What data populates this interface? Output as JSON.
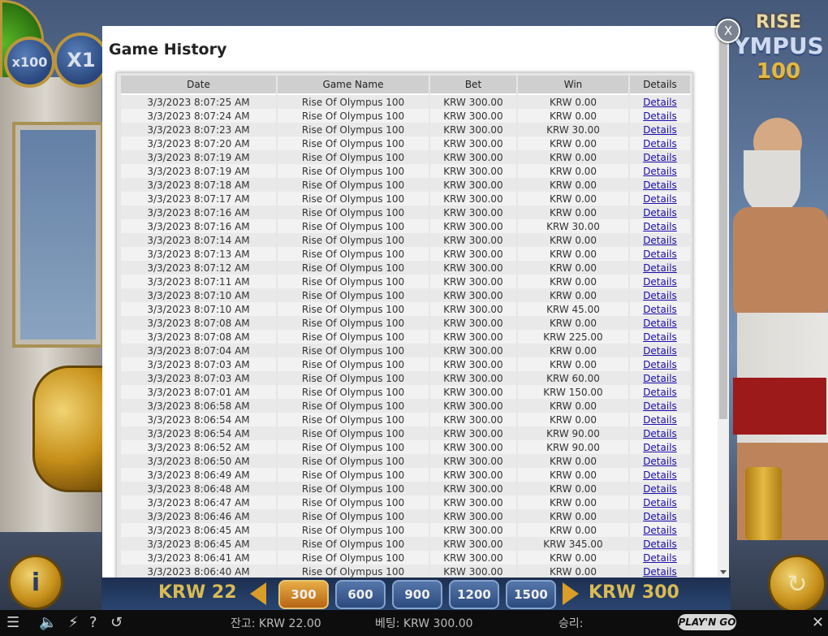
{
  "game": {
    "multipliers": [
      "x100",
      "X1"
    ],
    "logo": {
      "line1": "RISE",
      "line2": "YMPUS",
      "line3": "100"
    },
    "bet_bar": {
      "left_amount": "KRW 22",
      "right_amount": "KRW 300",
      "chips": [
        "300",
        "600",
        "900",
        "1200",
        "1500"
      ]
    },
    "info_label": "i"
  },
  "status_bar": {
    "balance": "잔고: KRW 22.00",
    "bet": "베팅: KRW 300.00",
    "win": "승리:",
    "brand": "PLAY'N GO",
    "icons": [
      "menu-icon",
      "sound-icon",
      "turbo-icon",
      "help-icon",
      "history-icon",
      "close-icon"
    ]
  },
  "modal": {
    "title": "Game History",
    "close_label": "X",
    "columns": [
      "Date",
      "Game Name",
      "Bet",
      "Win",
      "Details"
    ],
    "rows": [
      {
        "date": "3/3/2023 8:07:25 AM",
        "game": "Rise Of Olympus 100",
        "bet": "KRW 300.00",
        "win": "KRW 0.00",
        "details": "Details"
      },
      {
        "date": "3/3/2023 8:07:24 AM",
        "game": "Rise Of Olympus 100",
        "bet": "KRW 300.00",
        "win": "KRW 0.00",
        "details": "Details"
      },
      {
        "date": "3/3/2023 8:07:23 AM",
        "game": "Rise Of Olympus 100",
        "bet": "KRW 300.00",
        "win": "KRW 30.00",
        "details": "Details"
      },
      {
        "date": "3/3/2023 8:07:20 AM",
        "game": "Rise Of Olympus 100",
        "bet": "KRW 300.00",
        "win": "KRW 0.00",
        "details": "Details"
      },
      {
        "date": "3/3/2023 8:07:19 AM",
        "game": "Rise Of Olympus 100",
        "bet": "KRW 300.00",
        "win": "KRW 0.00",
        "details": "Details"
      },
      {
        "date": "3/3/2023 8:07:19 AM",
        "game": "Rise Of Olympus 100",
        "bet": "KRW 300.00",
        "win": "KRW 0.00",
        "details": "Details"
      },
      {
        "date": "3/3/2023 8:07:18 AM",
        "game": "Rise Of Olympus 100",
        "bet": "KRW 300.00",
        "win": "KRW 0.00",
        "details": "Details"
      },
      {
        "date": "3/3/2023 8:07:17 AM",
        "game": "Rise Of Olympus 100",
        "bet": "KRW 300.00",
        "win": "KRW 0.00",
        "details": "Details"
      },
      {
        "date": "3/3/2023 8:07:16 AM",
        "game": "Rise Of Olympus 100",
        "bet": "KRW 300.00",
        "win": "KRW 0.00",
        "details": "Details"
      },
      {
        "date": "3/3/2023 8:07:16 AM",
        "game": "Rise Of Olympus 100",
        "bet": "KRW 300.00",
        "win": "KRW 30.00",
        "details": "Details"
      },
      {
        "date": "3/3/2023 8:07:14 AM",
        "game": "Rise Of Olympus 100",
        "bet": "KRW 300.00",
        "win": "KRW 0.00",
        "details": "Details"
      },
      {
        "date": "3/3/2023 8:07:13 AM",
        "game": "Rise Of Olympus 100",
        "bet": "KRW 300.00",
        "win": "KRW 0.00",
        "details": "Details"
      },
      {
        "date": "3/3/2023 8:07:12 AM",
        "game": "Rise Of Olympus 100",
        "bet": "KRW 300.00",
        "win": "KRW 0.00",
        "details": "Details"
      },
      {
        "date": "3/3/2023 8:07:11 AM",
        "game": "Rise Of Olympus 100",
        "bet": "KRW 300.00",
        "win": "KRW 0.00",
        "details": "Details"
      },
      {
        "date": "3/3/2023 8:07:10 AM",
        "game": "Rise Of Olympus 100",
        "bet": "KRW 300.00",
        "win": "KRW 0.00",
        "details": "Details"
      },
      {
        "date": "3/3/2023 8:07:10 AM",
        "game": "Rise Of Olympus 100",
        "bet": "KRW 300.00",
        "win": "KRW 45.00",
        "details": "Details"
      },
      {
        "date": "3/3/2023 8:07:08 AM",
        "game": "Rise Of Olympus 100",
        "bet": "KRW 300.00",
        "win": "KRW 0.00",
        "details": "Details"
      },
      {
        "date": "3/3/2023 8:07:08 AM",
        "game": "Rise Of Olympus 100",
        "bet": "KRW 300.00",
        "win": "KRW 225.00",
        "details": "Details"
      },
      {
        "date": "3/3/2023 8:07:04 AM",
        "game": "Rise Of Olympus 100",
        "bet": "KRW 300.00",
        "win": "KRW 0.00",
        "details": "Details"
      },
      {
        "date": "3/3/2023 8:07:03 AM",
        "game": "Rise Of Olympus 100",
        "bet": "KRW 300.00",
        "win": "KRW 0.00",
        "details": "Details"
      },
      {
        "date": "3/3/2023 8:07:03 AM",
        "game": "Rise Of Olympus 100",
        "bet": "KRW 300.00",
        "win": "KRW 60.00",
        "details": "Details"
      },
      {
        "date": "3/3/2023 8:07:01 AM",
        "game": "Rise Of Olympus 100",
        "bet": "KRW 300.00",
        "win": "KRW 150.00",
        "details": "Details"
      },
      {
        "date": "3/3/2023 8:06:58 AM",
        "game": "Rise Of Olympus 100",
        "bet": "KRW 300.00",
        "win": "KRW 0.00",
        "details": "Details"
      },
      {
        "date": "3/3/2023 8:06:54 AM",
        "game": "Rise Of Olympus 100",
        "bet": "KRW 300.00",
        "win": "KRW 0.00",
        "details": "Details"
      },
      {
        "date": "3/3/2023 8:06:54 AM",
        "game": "Rise Of Olympus 100",
        "bet": "KRW 300.00",
        "win": "KRW 90.00",
        "details": "Details"
      },
      {
        "date": "3/3/2023 8:06:52 AM",
        "game": "Rise Of Olympus 100",
        "bet": "KRW 300.00",
        "win": "KRW 90.00",
        "details": "Details"
      },
      {
        "date": "3/3/2023 8:06:50 AM",
        "game": "Rise Of Olympus 100",
        "bet": "KRW 300.00",
        "win": "KRW 0.00",
        "details": "Details"
      },
      {
        "date": "3/3/2023 8:06:49 AM",
        "game": "Rise Of Olympus 100",
        "bet": "KRW 300.00",
        "win": "KRW 0.00",
        "details": "Details"
      },
      {
        "date": "3/3/2023 8:06:48 AM",
        "game": "Rise Of Olympus 100",
        "bet": "KRW 300.00",
        "win": "KRW 0.00",
        "details": "Details"
      },
      {
        "date": "3/3/2023 8:06:47 AM",
        "game": "Rise Of Olympus 100",
        "bet": "KRW 300.00",
        "win": "KRW 0.00",
        "details": "Details"
      },
      {
        "date": "3/3/2023 8:06:46 AM",
        "game": "Rise Of Olympus 100",
        "bet": "KRW 300.00",
        "win": "KRW 0.00",
        "details": "Details"
      },
      {
        "date": "3/3/2023 8:06:45 AM",
        "game": "Rise Of Olympus 100",
        "bet": "KRW 300.00",
        "win": "KRW 0.00",
        "details": "Details"
      },
      {
        "date": "3/3/2023 8:06:45 AM",
        "game": "Rise Of Olympus 100",
        "bet": "KRW 300.00",
        "win": "KRW 345.00",
        "details": "Details"
      },
      {
        "date": "3/3/2023 8:06:41 AM",
        "game": "Rise Of Olympus 100",
        "bet": "KRW 300.00",
        "win": "KRW 0.00",
        "details": "Details"
      },
      {
        "date": "3/3/2023 8:06:40 AM",
        "game": "Rise Of Olympus 100",
        "bet": "KRW 300.00",
        "win": "KRW 0.00",
        "details": "Details"
      }
    ]
  }
}
